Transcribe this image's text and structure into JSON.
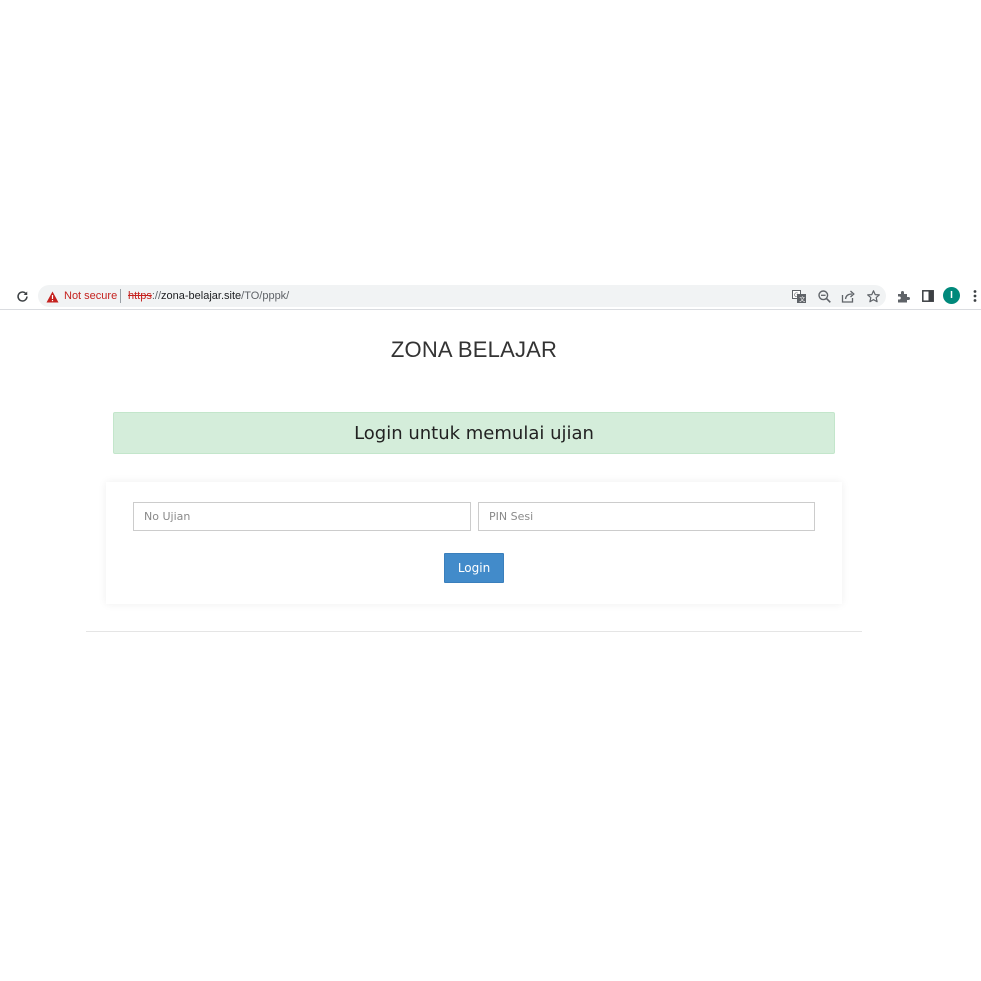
{
  "browser": {
    "security_label": "Not secure",
    "url": {
      "scheme": "https",
      "separator": "://",
      "host": "zona-belajar.site",
      "path": "/TO/pppk/"
    },
    "profile_initial": "I",
    "icons": [
      "reload-icon",
      "warning-icon",
      "translate-icon",
      "zoom-out-icon",
      "share-icon",
      "bookmark-star-icon",
      "extensions-icon",
      "side-panel-icon",
      "menu-kebab-icon"
    ],
    "colors": {
      "warning": "#c5221f",
      "omnibox_bg": "#f1f3f4",
      "avatar_bg": "#00897b"
    }
  },
  "page": {
    "site_title": "ZONA BELAJAR",
    "alert_text": "Login untuk memulai ujian",
    "form": {
      "no_ujian_placeholder": "No Ujian",
      "no_ujian_value": "",
      "pin_sesi_placeholder": "PIN Sesi",
      "pin_sesi_value": "",
      "login_label": "Login"
    },
    "colors": {
      "alert_bg": "#d4edda",
      "button_bg": "#428bca"
    }
  }
}
